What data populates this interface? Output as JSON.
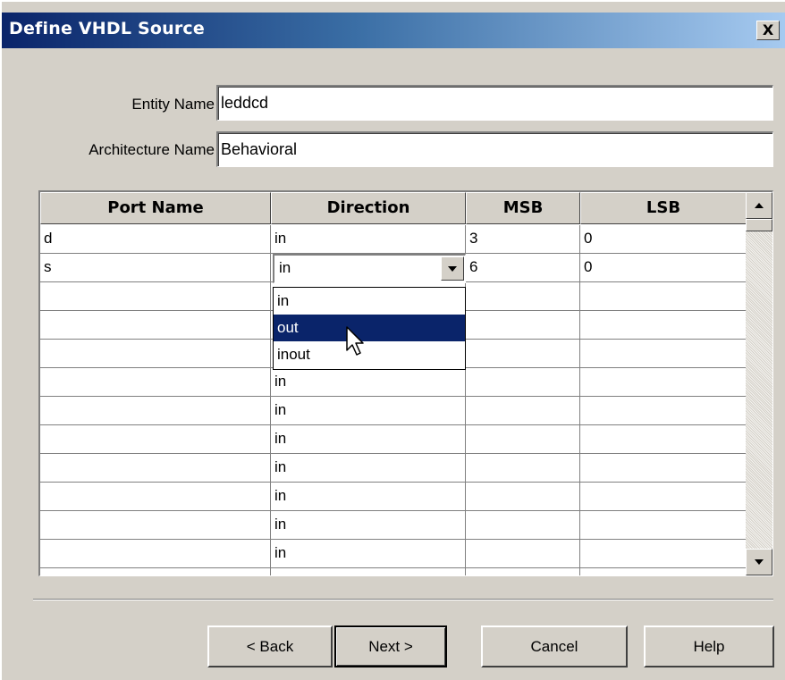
{
  "window": {
    "title": "Define VHDL Source",
    "close_label": "X"
  },
  "entity": {
    "label": "Entity Name",
    "value": "leddcd"
  },
  "architecture": {
    "label": "Architecture Name",
    "value": "Behavioral"
  },
  "table": {
    "headers": [
      "Port Name",
      "Direction",
      "MSB",
      "LSB"
    ],
    "rows": [
      {
        "port": "d",
        "direction": "in",
        "msb": "3",
        "lsb": "0"
      },
      {
        "port": "s",
        "direction": "in",
        "msb": "6",
        "lsb": "0"
      },
      {
        "port": "",
        "direction": "",
        "msb": "",
        "lsb": ""
      },
      {
        "port": "",
        "direction": "",
        "msb": "",
        "lsb": ""
      },
      {
        "port": "",
        "direction": "",
        "msb": "",
        "lsb": ""
      },
      {
        "port": "",
        "direction": "in",
        "msb": "",
        "lsb": ""
      },
      {
        "port": "",
        "direction": "in",
        "msb": "",
        "lsb": ""
      },
      {
        "port": "",
        "direction": "in",
        "msb": "",
        "lsb": ""
      },
      {
        "port": "",
        "direction": "in",
        "msb": "",
        "lsb": ""
      },
      {
        "port": "",
        "direction": "in",
        "msb": "",
        "lsb": ""
      },
      {
        "port": "",
        "direction": "in",
        "msb": "",
        "lsb": ""
      },
      {
        "port": "",
        "direction": "in",
        "msb": "",
        "lsb": ""
      },
      {
        "port": "",
        "direction": "",
        "msb": "",
        "lsb": ""
      }
    ]
  },
  "direction_combo": {
    "value": "in",
    "options": [
      "in",
      "out",
      "inout"
    ],
    "highlighted": "out"
  },
  "buttons": {
    "back": "< Back",
    "next": "Next >",
    "cancel": "Cancel",
    "help": "Help"
  },
  "colors": {
    "face": "#d4d0c8",
    "title_start": "#0a246a",
    "title_end": "#a6caf0",
    "selection": "#0a246a"
  }
}
